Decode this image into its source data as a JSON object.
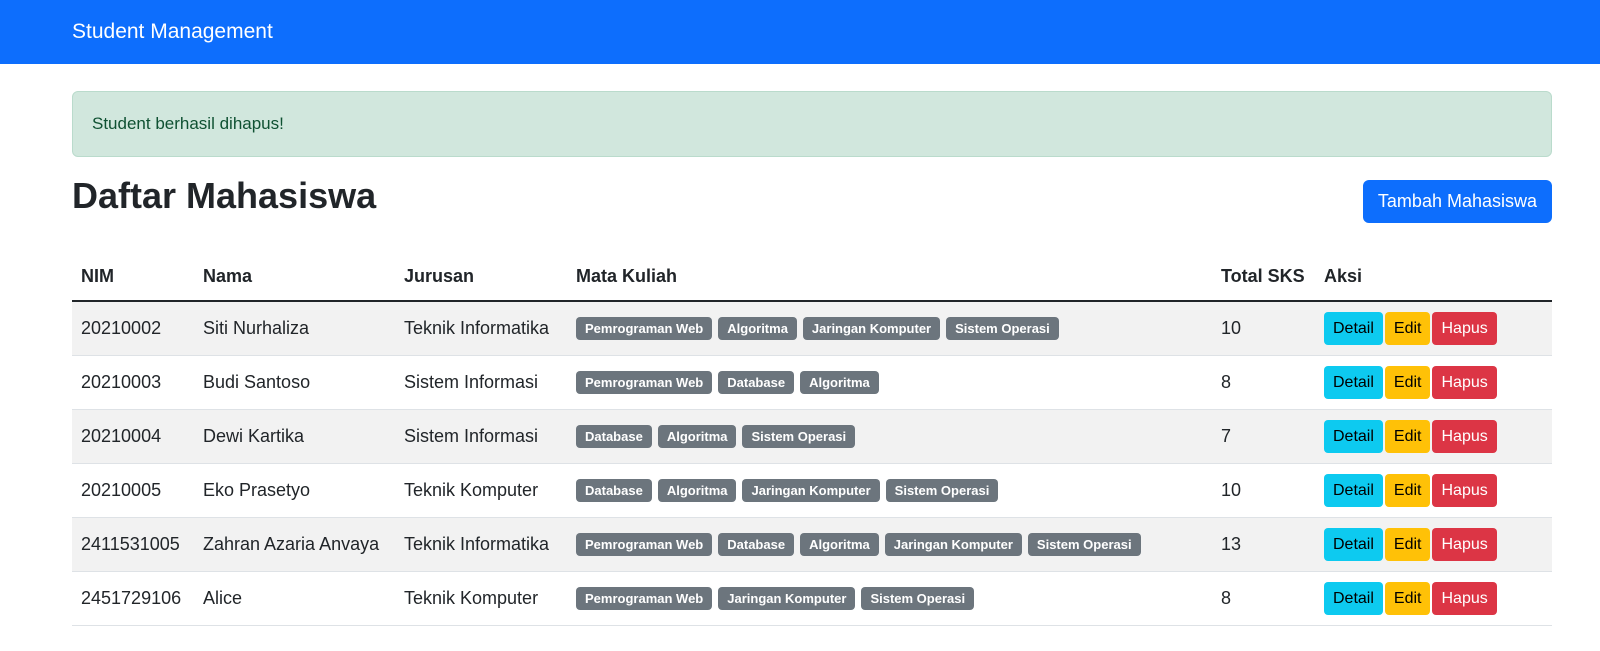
{
  "navbar": {
    "brand": "Student Management"
  },
  "alert": {
    "message": "Student berhasil dihapus!"
  },
  "page": {
    "title": "Daftar Mahasiswa",
    "add_button": "Tambah Mahasiswa"
  },
  "table": {
    "headers": [
      "NIM",
      "Nama",
      "Jurusan",
      "Mata Kuliah",
      "Total SKS",
      "Aksi"
    ],
    "actions": {
      "detail": "Detail",
      "edit": "Edit",
      "delete": "Hapus"
    },
    "rows": [
      {
        "nim": "20210002",
        "nama": "Siti Nurhaliza",
        "jurusan": "Teknik Informatika",
        "courses": [
          "Pemrograman Web",
          "Algoritma",
          "Jaringan Komputer",
          "Sistem Operasi"
        ],
        "sks": "10"
      },
      {
        "nim": "20210003",
        "nama": "Budi Santoso",
        "jurusan": "Sistem Informasi",
        "courses": [
          "Pemrograman Web",
          "Database",
          "Algoritma"
        ],
        "sks": "8"
      },
      {
        "nim": "20210004",
        "nama": "Dewi Kartika",
        "jurusan": "Sistem Informasi",
        "courses": [
          "Database",
          "Algoritma",
          "Sistem Operasi"
        ],
        "sks": "7"
      },
      {
        "nim": "20210005",
        "nama": "Eko Prasetyo",
        "jurusan": "Teknik Komputer",
        "courses": [
          "Database",
          "Algoritma",
          "Jaringan Komputer",
          "Sistem Operasi"
        ],
        "sks": "10"
      },
      {
        "nim": "2411531005",
        "nama": "Zahran Azaria Anvaya",
        "jurusan": "Teknik Informatika",
        "courses": [
          "Pemrograman Web",
          "Database",
          "Algoritma",
          "Jaringan Komputer",
          "Sistem Operasi"
        ],
        "sks": "13"
      },
      {
        "nim": "2451729106",
        "nama": "Alice",
        "jurusan": "Teknik Komputer",
        "courses": [
          "Pemrograman Web",
          "Jaringan Komputer",
          "Sistem Operasi"
        ],
        "sks": "8"
      }
    ]
  },
  "colors": {
    "primary": "#0d6efd",
    "success_bg": "#d1e7dd",
    "success_text": "#0f5132",
    "info": "#0dcaf0",
    "warning": "#ffc107",
    "danger": "#dc3545",
    "badge": "#6c757d"
  }
}
